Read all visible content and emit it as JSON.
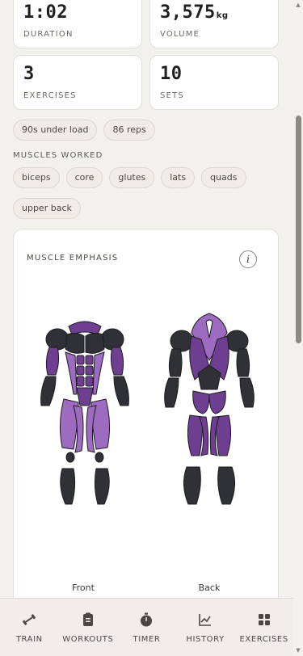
{
  "stats": [
    {
      "value": "1:02",
      "unit": "",
      "label": "DURATION"
    },
    {
      "value": "3,575",
      "unit": "kg",
      "label": "VOLUME"
    },
    {
      "value": "3",
      "unit": "",
      "label": "EXERCISES"
    },
    {
      "value": "10",
      "unit": "",
      "label": "SETS"
    }
  ],
  "summary_chips": [
    "90s under load",
    "86 reps"
  ],
  "muscles_worked": {
    "label": "MUSCLES WORKED",
    "chips": [
      "biceps",
      "core",
      "glutes",
      "lats",
      "quads",
      "upper back"
    ]
  },
  "muscle_emphasis": {
    "title": "MUSCLE EMPHASIS",
    "info_label": "i",
    "front_label": "Front",
    "back_label": "Back",
    "colors": {
      "high": "#6e3e91",
      "medium": "#9d6bbf",
      "inactive": "#2f3137",
      "outline": "#1c1c20"
    }
  },
  "nav": [
    {
      "label": "TRAIN",
      "icon": "dumbbell-icon"
    },
    {
      "label": "WORKOUTS",
      "icon": "clipboard-icon"
    },
    {
      "label": "TIMER",
      "icon": "stopwatch-icon"
    },
    {
      "label": "HISTORY",
      "icon": "chart-line-icon"
    },
    {
      "label": "EXERCISES",
      "icon": "grid-icon"
    }
  ]
}
